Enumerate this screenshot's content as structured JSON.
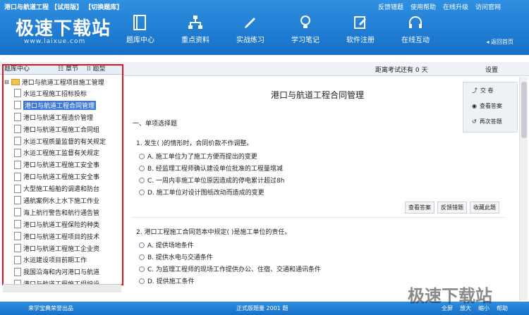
{
  "app": {
    "title": "港口与航道工程 【试用版】 【切换题库】",
    "logo": "极速下载站",
    "logo_url": "www.laixue.com",
    "top_links": [
      "反馈错题",
      "使用帮助",
      "在线升级",
      "访问官网"
    ],
    "back_home": "◂ 返回首页"
  },
  "nav": [
    {
      "label": "题库中心",
      "icon": "book-icon"
    },
    {
      "label": "重点资料",
      "icon": "network-icon"
    },
    {
      "label": "实战练习",
      "icon": "pen-icon"
    },
    {
      "label": "学习笔记",
      "icon": "bulb-icon"
    },
    {
      "label": "软件注册",
      "icon": "register-icon"
    },
    {
      "label": "在线互动",
      "icon": "headset-icon"
    }
  ],
  "left": {
    "tabs": [
      "题库中心",
      "章节",
      "题型"
    ],
    "root": "港口与航道工程项目施工管理",
    "items": [
      "水运工程施工招标投标",
      "港口与航道工程合同管理",
      "港口与航道工程造价管理",
      "港口与航道工程施工合同组",
      "水运工程质量监督的有关规定",
      "水运工程施工监督有关规定",
      "港口与航道工程施工安全事",
      "港口与航道工程施工安全事",
      "大型施工船舶的调遣和防台",
      "通航案例水上水下施工作业",
      "海上航行警告和航行通告管",
      "港口与航道工程保险的种类",
      "港口与航道工程项目的技术",
      "港口与航道工程施工企业资",
      "水运建设项目前期工作",
      "我国沿海和内河港口与航道",
      "港口与航道工程施工组织设"
    ],
    "selected_index": 1
  },
  "topbar": {
    "countdown": "距离考试还有 0 天",
    "settings": "设置"
  },
  "main": {
    "paper_title": "港口与航道工程合同管理",
    "section": "一、单项选择题",
    "questions": [
      {
        "stem": "1. 发生( )的情形时，合同价款不作调整。",
        "options": [
          "A. 施工单位为了施工方便而提出的变更",
          "B. 经监理工程师确认建设单位批准的工程量增减",
          "C. 一周内非施工单位原因造成的停电累计超过8h",
          "D. 施工单位对设计图纸改动而造成的变更"
        ]
      },
      {
        "stem": "2. 港口工程施工合同范本中规定( )是施工单位的责任。",
        "options": [
          "A. 提供场地条件",
          "B. 提供水电与交通条件",
          "C. 为监理工程师的现场工作提供办公、住宿、交通和通讯条件",
          "D. 提供施工条件"
        ]
      }
    ],
    "actions": [
      "查看答案",
      "反馈错题",
      "收藏此题"
    ]
  },
  "right_panel": [
    "交 卷",
    "查看答案",
    "再次答题"
  ],
  "bottom": {
    "left": "来学宝典荣誉出品",
    "center": "正式版题量 2001 题",
    "right": [
      "全屏",
      "放大",
      "缩小",
      "帮助"
    ]
  },
  "watermark": "极速下载站",
  "colors": {
    "header_blue": "#1f7fd8",
    "selected_blue": "#3c78d8",
    "frame_red": "#e0141e"
  }
}
